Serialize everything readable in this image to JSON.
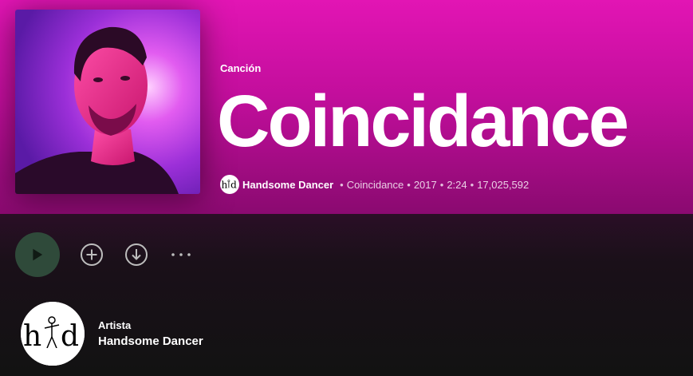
{
  "track": {
    "type_label": "Canción",
    "title": "Coincidance",
    "artist": "Handsome Dancer",
    "album": "Coincidance",
    "year": "2017",
    "duration": "2:24",
    "plays": "17,025,592",
    "separator": "•"
  },
  "actions": {
    "play_icon": "play-icon",
    "add_icon": "plus-circle-icon",
    "download_icon": "download-icon",
    "more_icon": "more-dots-icon"
  },
  "artist_card": {
    "label": "Artista",
    "name": "Handsome Dancer"
  },
  "colors": {
    "header_top": "#e215b4",
    "header_bottom": "#8a0a70",
    "background": "#121212",
    "play_button": "#2f4a3a"
  }
}
